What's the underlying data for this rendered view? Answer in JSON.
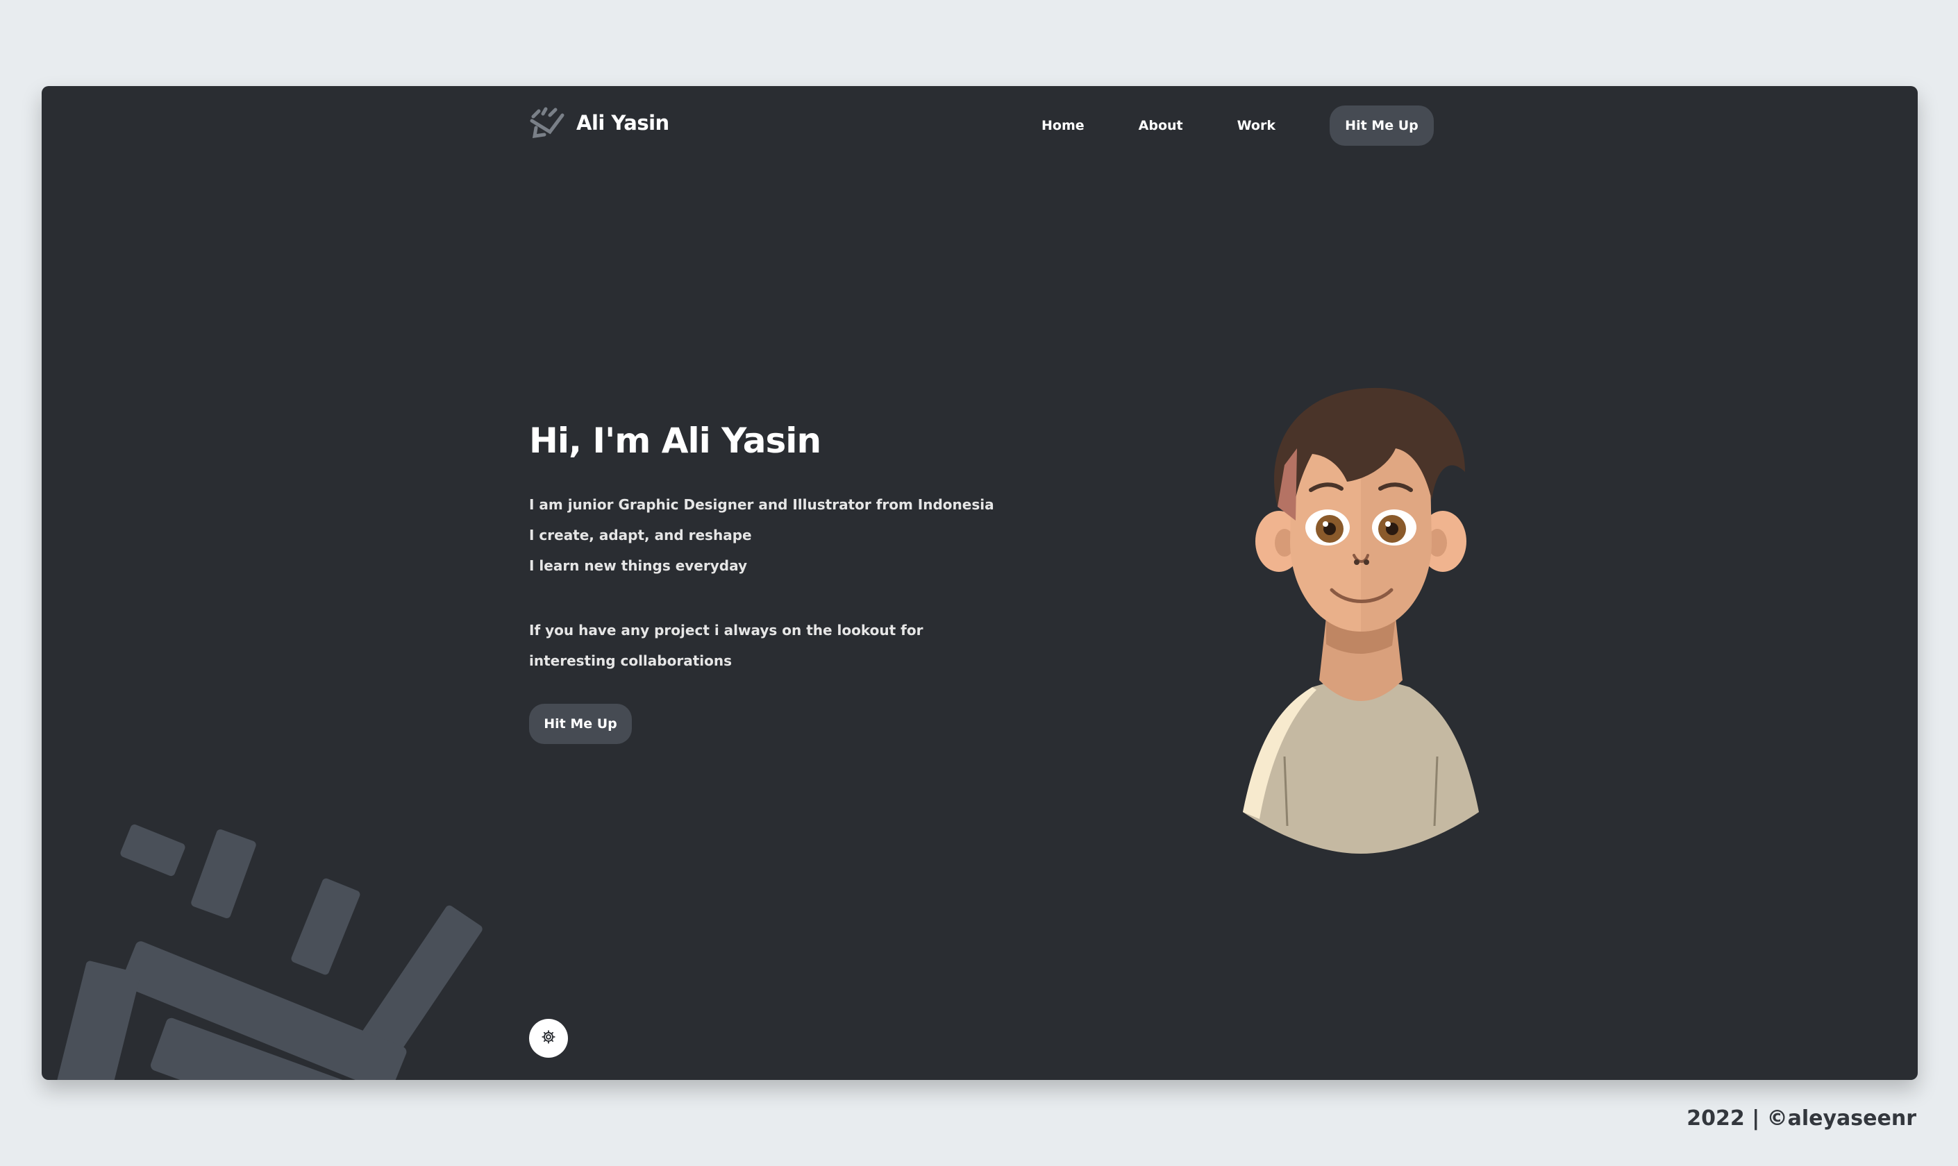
{
  "brand": {
    "name": "Ali Yasin",
    "icon": "scribble-logo-icon"
  },
  "nav": {
    "items": [
      {
        "label": "Home"
      },
      {
        "label": "About"
      },
      {
        "label": "Work"
      }
    ],
    "cta_label": "Hit Me Up"
  },
  "hero": {
    "title": "Hi, I'm Ali Yasin",
    "lines": [
      "I am junior Graphic Designer and Illustrator from Indonesia",
      "I create, adapt, and reshape",
      "I learn new things everyday"
    ],
    "paragraph": "If you have any project i always on the lookout for interesting collaborations",
    "button_label": "Hit Me Up"
  },
  "settings": {
    "icon": "gear-icon"
  },
  "footer": {
    "credit": "2022 | ©aleyaseenr"
  },
  "colors": {
    "page_bg": "#e8ecef",
    "card_bg": "#2a2d32",
    "button_bg": "#464b53",
    "decor_gray": "#4a5059",
    "text_light": "#ffffff",
    "footer_text": "#33373d"
  }
}
